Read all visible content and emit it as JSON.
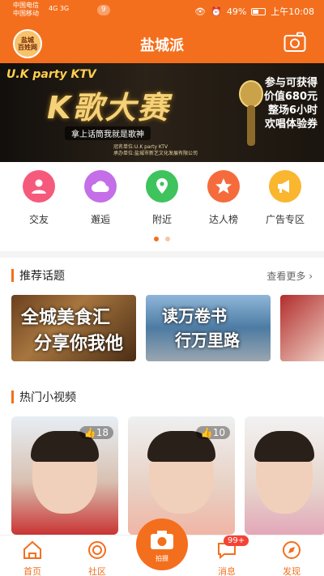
{
  "status": {
    "carrier1": "中国电信",
    "carrier2": "中国移动",
    "signal_text": "4G 3G",
    "notif_count": "9",
    "battery": "49%",
    "time": "上午10:08"
  },
  "header": {
    "logo_text": "盐城\n百姓网",
    "title": "盐城派"
  },
  "banner": {
    "top_text": "U.K party KTV",
    "main_text": "K歌大赛",
    "sub_text": "拿上话筒我就是歌神",
    "small_text": "冠名单位:U.K party KTV\n承办单位:盐城市新艺文化发展有限公司",
    "right_lines": [
      "参与可获得",
      "价值680元",
      "整场6小时",
      "欢唱体验券"
    ]
  },
  "quick_menu": [
    {
      "label": "交友",
      "icon": "people-icon",
      "color": "#f55a7c"
    },
    {
      "label": "邂逅",
      "icon": "cloud-icon",
      "color": "#c46ee8"
    },
    {
      "label": "附近",
      "icon": "location-icon",
      "color": "#3fc35c"
    },
    {
      "label": "达人榜",
      "icon": "star-icon",
      "color": "#f56b3c"
    },
    {
      "label": "广告专区",
      "icon": "megaphone-icon",
      "color": "#f9b62e"
    }
  ],
  "topics_section": {
    "title": "推荐话题",
    "more": "查看更多",
    "items": [
      {
        "line1": "全城美食汇",
        "line2": "分享你我他"
      },
      {
        "line1": "读万卷书",
        "line2": "行万里路"
      },
      {
        "line1": "",
        "line2": ""
      }
    ]
  },
  "videos_section": {
    "title": "热门小视频",
    "items": [
      {
        "likes": "18"
      },
      {
        "likes": "10"
      },
      {
        "likes": ""
      }
    ]
  },
  "tabbar": {
    "home": "首页",
    "community": "社区",
    "shoot": "拍摄",
    "messages": "消息",
    "messages_badge": "99+",
    "discover": "发现"
  },
  "colors": {
    "brand": "#f46f1d"
  }
}
